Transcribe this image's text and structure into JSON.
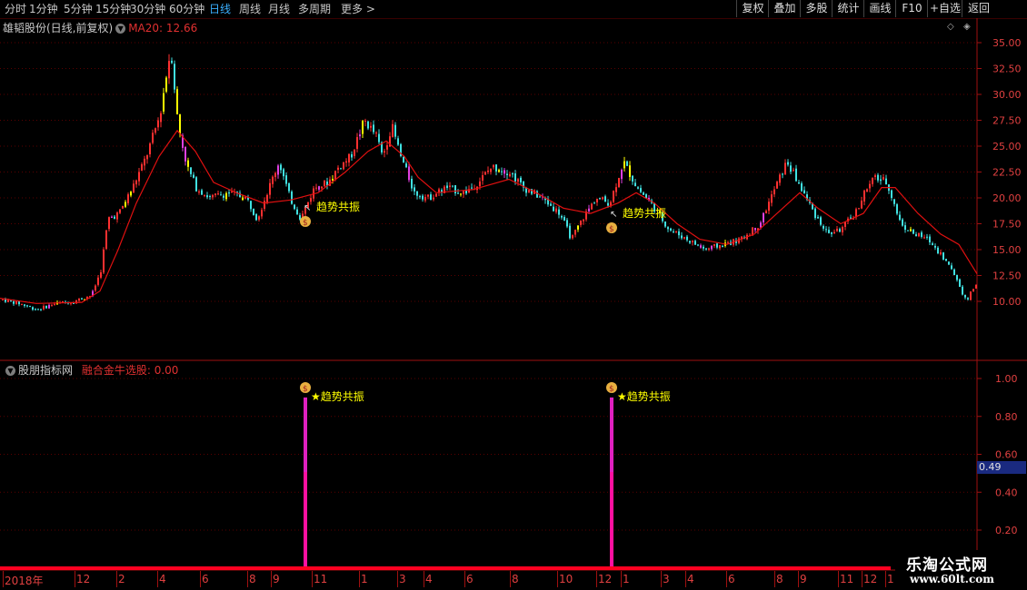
{
  "toolbar": {
    "periods": [
      "分时",
      "1分钟",
      "5分钟",
      "15分钟",
      "30分钟",
      "60分钟",
      "日线",
      "周线",
      "月线",
      "多周期",
      "更多 >"
    ],
    "active_period": "日线",
    "right_buttons": [
      "复权",
      "叠加",
      "多股",
      "统计",
      "画线",
      "F10",
      "+自选",
      "返回"
    ]
  },
  "main_panel": {
    "stock_name": "雄韬股份(日线,前复权)",
    "ma_label": "MA20: 12.66",
    "signal_text": "趋势共振",
    "y_ticks": [
      "35.00",
      "32.50",
      "30.00",
      "27.50",
      "25.00",
      "22.50",
      "20.00",
      "17.50",
      "15.00",
      "12.50",
      "10.00"
    ],
    "colors": {
      "up": "#ff3030",
      "down": "#40e0e0",
      "ma": "#e01010",
      "signal": "#ffff00",
      "special": "#e040e0"
    }
  },
  "sub_panel": {
    "indicator_name": "股朋指标网",
    "formula_label": "融合金牛选股: 0.00",
    "signal_text": "★趋势共振",
    "y_ticks": [
      "1.00",
      "0.80",
      "0.60",
      "0.40",
      "0.20"
    ],
    "current_value": "0.49"
  },
  "x_axis": {
    "labels": [
      "2018年",
      "12",
      "2",
      "4",
      "6",
      "8",
      "9",
      "11",
      "1",
      "3",
      "4",
      "6",
      "8",
      "10",
      "12",
      "1",
      "3",
      "4",
      "6",
      "8",
      "9",
      "11",
      "12",
      "1"
    ]
  },
  "watermark": {
    "line1": "乐淘公式网",
    "line2": "www.60lt.com"
  },
  "chart_data": {
    "type": "candlestick",
    "title": "雄韬股份(日线,前复权)",
    "ylim": [
      8,
      37
    ],
    "ma20_last": 12.66,
    "price_path": [
      [
        0,
        10.2
      ],
      [
        20,
        9.8
      ],
      [
        40,
        9.2
      ],
      [
        60,
        9.8
      ],
      [
        80,
        10.0
      ],
      [
        100,
        10.6
      ],
      [
        110,
        13.0
      ],
      [
        118,
        18.0
      ],
      [
        130,
        18.5
      ],
      [
        145,
        21.0
      ],
      [
        160,
        24.0
      ],
      [
        175,
        28.0
      ],
      [
        187,
        34.5
      ],
      [
        195,
        27.0
      ],
      [
        205,
        23.0
      ],
      [
        215,
        21.0
      ],
      [
        230,
        20.0
      ],
      [
        250,
        20.5
      ],
      [
        270,
        20.0
      ],
      [
        282,
        18.0
      ],
      [
        295,
        21.0
      ],
      [
        306,
        23.5
      ],
      [
        318,
        20.0
      ],
      [
        330,
        18.0
      ],
      [
        345,
        21.0
      ],
      [
        360,
        21.5
      ],
      [
        372,
        23.0
      ],
      [
        385,
        24.0
      ],
      [
        400,
        27.5
      ],
      [
        413,
        26.0
      ],
      [
        420,
        24.0
      ],
      [
        430,
        27.0
      ],
      [
        440,
        24.0
      ],
      [
        455,
        20.5
      ],
      [
        470,
        20.0
      ],
      [
        490,
        21.0
      ],
      [
        510,
        20.5
      ],
      [
        525,
        21.5
      ],
      [
        540,
        23.0
      ],
      [
        560,
        22.5
      ],
      [
        575,
        21.0
      ],
      [
        595,
        20.0
      ],
      [
        615,
        18.5
      ],
      [
        628,
        16.0
      ],
      [
        640,
        18.0
      ],
      [
        655,
        20.0
      ],
      [
        670,
        19.5
      ],
      [
        685,
        23.5
      ],
      [
        700,
        21.0
      ],
      [
        715,
        19.5
      ],
      [
        735,
        17.0
      ],
      [
        755,
        16.0
      ],
      [
        775,
        15.0
      ],
      [
        795,
        15.5
      ],
      [
        815,
        16.0
      ],
      [
        835,
        17.5
      ],
      [
        852,
        21.0
      ],
      [
        865,
        23.5
      ],
      [
        880,
        21.0
      ],
      [
        895,
        18.5
      ],
      [
        910,
        16.5
      ],
      [
        925,
        17.0
      ],
      [
        940,
        18.5
      ],
      [
        950,
        20.5
      ],
      [
        962,
        22.0
      ],
      [
        975,
        21.5
      ],
      [
        990,
        17.5
      ],
      [
        1005,
        16.5
      ],
      [
        1020,
        16.0
      ],
      [
        1035,
        14.5
      ],
      [
        1050,
        12.5
      ],
      [
        1062,
        10.0
      ],
      [
        1075,
        12.0
      ]
    ],
    "ma20_path": [
      [
        0,
        10.3
      ],
      [
        40,
        9.8
      ],
      [
        90,
        9.9
      ],
      [
        110,
        11.0
      ],
      [
        130,
        15.0
      ],
      [
        150,
        19.5
      ],
      [
        175,
        24.0
      ],
      [
        195,
        26.5
      ],
      [
        215,
        24.5
      ],
      [
        235,
        21.5
      ],
      [
        260,
        20.5
      ],
      [
        290,
        19.5
      ],
      [
        320,
        19.8
      ],
      [
        350,
        20.5
      ],
      [
        380,
        22.5
      ],
      [
        405,
        24.5
      ],
      [
        425,
        25.5
      ],
      [
        445,
        24.0
      ],
      [
        460,
        22.0
      ],
      [
        480,
        20.5
      ],
      [
        520,
        20.8
      ],
      [
        560,
        21.8
      ],
      [
        590,
        20.5
      ],
      [
        620,
        19.0
      ],
      [
        650,
        18.5
      ],
      [
        680,
        19.5
      ],
      [
        700,
        20.5
      ],
      [
        720,
        19.5
      ],
      [
        745,
        17.5
      ],
      [
        770,
        16.0
      ],
      [
        800,
        15.5
      ],
      [
        830,
        16.5
      ],
      [
        855,
        18.5
      ],
      [
        880,
        20.5
      ],
      [
        900,
        19.0
      ],
      [
        925,
        17.5
      ],
      [
        950,
        18.5
      ],
      [
        970,
        21.0
      ],
      [
        985,
        21.0
      ],
      [
        1010,
        18.5
      ],
      [
        1035,
        16.5
      ],
      [
        1055,
        15.5
      ],
      [
        1075,
        12.66
      ]
    ],
    "signals": [
      {
        "x": 336,
        "label": "趋势共振"
      },
      {
        "x": 673,
        "label": "趋势共振"
      }
    ],
    "indicator": {
      "name": "融合金牛选股",
      "ylim": [
        0.1,
        1.05
      ],
      "spikes": [
        {
          "x": 336,
          "value": 0.95
        },
        {
          "x": 673,
          "value": 0.95
        }
      ]
    }
  }
}
